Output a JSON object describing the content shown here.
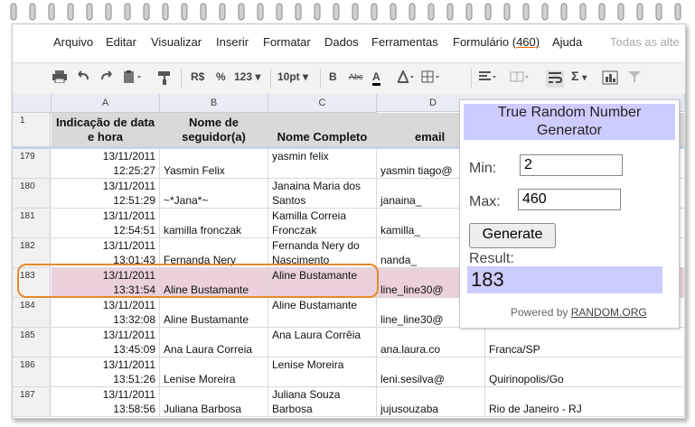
{
  "menu": {
    "items": [
      "Arquivo",
      "Editar",
      "Visualizar",
      "Inserir",
      "Formatar",
      "Dados",
      "Ferramentas"
    ],
    "form_label": "Formulário",
    "form_count": "(460)",
    "help": "Ajuda",
    "all_changes": "Todas as alte"
  },
  "toolbar": {
    "currency": "R$",
    "percent": "%",
    "number_format": "123",
    "font_size": "10pt",
    "bold": "B",
    "strike": "Abc",
    "font_color": "A",
    "sum": "Σ"
  },
  "columns": [
    "A",
    "B",
    "C",
    "D"
  ],
  "header_row": {
    "num": "1",
    "a": "Indicação de data e hora",
    "b": "Nome de seguidor(a)",
    "c": "Nome Completo",
    "d": "email"
  },
  "rows": [
    {
      "num": "179",
      "date": "13/11/2011",
      "time": "12:25:27",
      "b": "Yasmin Felix",
      "c": "yasmin felix",
      "d": "yasmin tiago@",
      "e": ""
    },
    {
      "num": "180",
      "date": "13/11/2011",
      "time": "12:51:29",
      "b": "~*Jana*~",
      "c": "Janaina Maria dos Santos",
      "d": "janaina_",
      "e": ""
    },
    {
      "num": "181",
      "date": "13/11/2011",
      "time": "12:54:51",
      "b": "kamilla fronczak",
      "c": "Kamilla Correia Fronczak",
      "d": "kamilla_",
      "e": ""
    },
    {
      "num": "182",
      "date": "13/11/2011",
      "time": "13:01:43",
      "b": "Fernanda Nery",
      "c": "Fernanda Nery do Nascimento",
      "d": "nanda_",
      "e": ""
    },
    {
      "num": "183",
      "date": "13/11/2011",
      "time": "13:31:54",
      "b": "Aline Bustamante",
      "c": "Aline Bustamante",
      "d": "line_line30@",
      "e": ""
    },
    {
      "num": "184",
      "date": "13/11/2011",
      "time": "13:32:08",
      "b": "Aline Bustamante",
      "c": "Aline Bustamante",
      "d": "line_line30@",
      "e": ""
    },
    {
      "num": "185",
      "date": "13/11/2011",
      "time": "13:45:09",
      "b": "Ana Laura Correia",
      "c": "Ana Laura Corrêia",
      "d": "ana.laura.co",
      "e": "Franca/SP"
    },
    {
      "num": "186",
      "date": "13/11/2011",
      "time": "13:51:26",
      "b": "Lenise Moreira",
      "c": "Lenise Moreira",
      "d": "leni.sesilva@",
      "e": "Quirinopolis/Go"
    },
    {
      "num": "187",
      "date": "13/11/2011",
      "time": "13:58:56",
      "b": "Juliana Barbosa",
      "c": "Juliana Souza Barbosa",
      "d": "jujusouzaba",
      "e": "Rio de Janeiro - RJ"
    }
  ],
  "rng": {
    "title": "True Random Number Generator",
    "min_label": "Min:",
    "min_value": "2",
    "max_label": "Max:",
    "max_value": "460",
    "button": "Generate",
    "result_label": "Result:",
    "result_value": "183",
    "powered_prefix": "Powered by",
    "powered_link": "RANDOM.ORG"
  },
  "colors": {
    "highlight_row": "#ead1dc",
    "rng_accent": "#ccccff",
    "circle": "#e58a2e"
  }
}
